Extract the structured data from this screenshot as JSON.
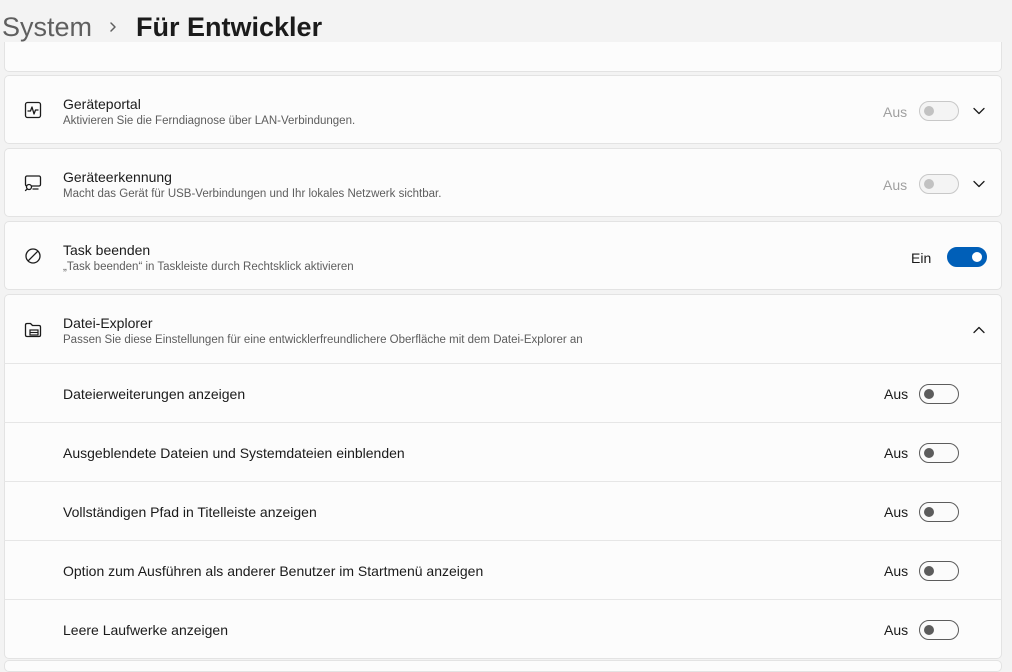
{
  "breadcrumb": {
    "parent": "System",
    "current": "Für Entwickler"
  },
  "settings": [
    {
      "title": "Geräteportal",
      "description": "Aktivieren Sie die Ferndiagnose über LAN-Verbindungen.",
      "state": "Aus",
      "toggle": "disabled",
      "icon": "pulse-monitor-icon",
      "expander": "chevron-down-icon"
    },
    {
      "title": "Geräteerkennung",
      "description": "Macht das Gerät für USB-Verbindungen und Ihr lokales Netzwerk sichtbar.",
      "state": "Aus",
      "toggle": "disabled",
      "icon": "device-search-icon",
      "expander": "chevron-down-icon"
    },
    {
      "title": "Task beenden",
      "description": "„Task beenden“ in Taskleiste durch Rechtsklick aktivieren",
      "state": "Ein",
      "toggle": "on",
      "icon": "block-icon"
    }
  ],
  "file_explorer": {
    "title": "Datei-Explorer",
    "description": "Passen Sie diese Einstellungen für eine entwicklerfreundlichere Oberfläche mit dem Datei-Explorer an",
    "icon": "folder-icon",
    "expander": "chevron-up-icon",
    "options": [
      {
        "label": "Dateierweiterungen anzeigen",
        "state": "Aus"
      },
      {
        "label": "Ausgeblendete Dateien und Systemdateien einblenden",
        "state": "Aus"
      },
      {
        "label": "Vollständigen Pfad in Titelleiste anzeigen",
        "state": "Aus"
      },
      {
        "label": "Option zum Ausführen als anderer Benutzer im Startmenü anzeigen",
        "state": "Aus"
      },
      {
        "label": "Leere Laufwerke anzeigen",
        "state": "Aus"
      }
    ]
  },
  "colors": {
    "accent": "#005fb8",
    "card": "#fcfcfc",
    "background": "#f3f3f3"
  }
}
